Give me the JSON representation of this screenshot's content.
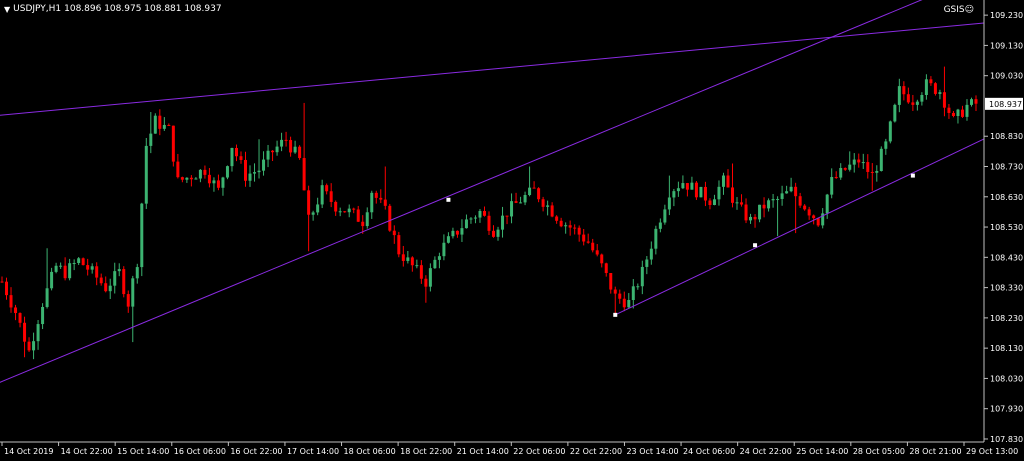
{
  "header": {
    "symbol": "USDJPY,H1",
    "ohlc": "108.896 108.975 108.881 108.937",
    "indicator": "GSIS☺"
  },
  "current_price": "108.937",
  "colors": {
    "background": "#000000",
    "bull_candle": "#3cb371",
    "bear_candle": "#ff0000",
    "trendline": "#8a2be2",
    "axis_text": "#ffffff",
    "price_box": "#ffffff"
  },
  "chart_data": {
    "type": "candlestick",
    "symbol": "USDJPY",
    "timeframe": "H1",
    "ylim": [
      107.82,
      109.28
    ],
    "y_ticks": [
      "109.230",
      "109.130",
      "109.030",
      "108.937",
      "108.830",
      "108.730",
      "108.630",
      "108.530",
      "108.430",
      "108.330",
      "108.230",
      "108.130",
      "108.030",
      "107.930",
      "107.830"
    ],
    "x_ticks": [
      "14 Oct 2019",
      "14 Oct 22:00",
      "15 Oct 14:00",
      "16 Oct 06:00",
      "16 Oct 22:00",
      "17 Oct 14:00",
      "18 Oct 06:00",
      "18 Oct 22:00",
      "21 Oct 14:00",
      "22 Oct 06:00",
      "22 Oct 22:00",
      "23 Oct 14:00",
      "24 Oct 06:00",
      "24 Oct 22:00",
      "25 Oct 14:00",
      "28 Oct 05:00",
      "28 Oct 21:00",
      "29 Oct 13:00"
    ],
    "close_path": [
      [
        0,
        108.35
      ],
      [
        3,
        108.25
      ],
      [
        6,
        108.12
      ],
      [
        9,
        108.28
      ],
      [
        12,
        108.4
      ],
      [
        14,
        108.38
      ],
      [
        17,
        108.42
      ],
      [
        20,
        108.38
      ],
      [
        23,
        108.33
      ],
      [
        26,
        108.38
      ],
      [
        28,
        108.28
      ],
      [
        30,
        108.42
      ],
      [
        32,
        108.8
      ],
      [
        34,
        108.88
      ],
      [
        37,
        108.85
      ],
      [
        39,
        108.68
      ],
      [
        42,
        108.7
      ],
      [
        45,
        108.72
      ],
      [
        48,
        108.65
      ],
      [
        51,
        108.8
      ],
      [
        54,
        108.7
      ],
      [
        57,
        108.72
      ],
      [
        60,
        108.78
      ],
      [
        63,
        108.82
      ],
      [
        66,
        108.75
      ],
      [
        68,
        108.55
      ],
      [
        71,
        108.65
      ],
      [
        74,
        108.6
      ],
      [
        77,
        108.58
      ],
      [
        80,
        108.55
      ],
      [
        82,
        108.65
      ],
      [
        85,
        108.58
      ],
      [
        88,
        108.45
      ],
      [
        91,
        108.4
      ],
      [
        94,
        108.35
      ],
      [
        97,
        108.45
      ],
      [
        100,
        108.5
      ],
      [
        103,
        108.55
      ],
      [
        106,
        108.58
      ],
      [
        109,
        108.52
      ],
      [
        112,
        108.58
      ],
      [
        115,
        108.62
      ],
      [
        118,
        108.65
      ],
      [
        121,
        108.6
      ],
      [
        124,
        108.55
      ],
      [
        127,
        108.52
      ],
      [
        130,
        108.48
      ],
      [
        133,
        108.4
      ],
      [
        136,
        108.3
      ],
      [
        139,
        108.28
      ],
      [
        142,
        108.38
      ],
      [
        145,
        108.52
      ],
      [
        148,
        108.65
      ],
      [
        151,
        108.68
      ],
      [
        154,
        108.65
      ],
      [
        157,
        108.62
      ],
      [
        160,
        108.68
      ],
      [
        163,
        108.6
      ],
      [
        166,
        108.55
      ],
      [
        169,
        108.6
      ],
      [
        172,
        108.62
      ],
      [
        175,
        108.65
      ],
      [
        178,
        108.6
      ],
      [
        181,
        108.55
      ],
      [
        184,
        108.68
      ],
      [
        187,
        108.72
      ],
      [
        190,
        108.75
      ],
      [
        193,
        108.7
      ],
      [
        196,
        108.8
      ],
      [
        199,
        108.98
      ],
      [
        202,
        108.95
      ],
      [
        205,
        109.0
      ],
      [
        208,
        108.98
      ],
      [
        211,
        108.88
      ],
      [
        214,
        108.93
      ],
      [
        216,
        108.937
      ]
    ],
    "highs": [
      [
        10,
        108.46
      ],
      [
        33,
        108.91
      ],
      [
        57,
        108.82
      ],
      [
        67,
        108.94
      ],
      [
        85,
        108.73
      ],
      [
        117,
        108.73
      ],
      [
        148,
        108.7
      ],
      [
        162,
        108.74
      ],
      [
        188,
        108.78
      ],
      [
        209,
        109.06
      ]
    ],
    "lows": [
      [
        5,
        108.1
      ],
      [
        29,
        108.15
      ],
      [
        68,
        108.45
      ],
      [
        94,
        108.28
      ],
      [
        136,
        108.24
      ],
      [
        172,
        108.5
      ],
      [
        176,
        108.51
      ],
      [
        193,
        108.65
      ]
    ],
    "trendlines": [
      {
        "points": [
          [
            0,
            108.9
          ],
          [
            216,
            109.2
          ]
        ],
        "style": "resistance"
      },
      {
        "points": [
          [
            0,
            108.02
          ],
          [
            205,
            109.28
          ]
        ],
        "style": "support-1"
      },
      {
        "points": [
          [
            136,
            108.24
          ],
          [
            216,
            108.8
          ]
        ],
        "style": "support-2"
      }
    ],
    "anchors": [
      [
        99,
        108.62
      ],
      [
        136,
        108.24
      ],
      [
        167,
        108.47
      ],
      [
        202,
        108.7
      ]
    ],
    "legend": "none",
    "grid": false
  }
}
